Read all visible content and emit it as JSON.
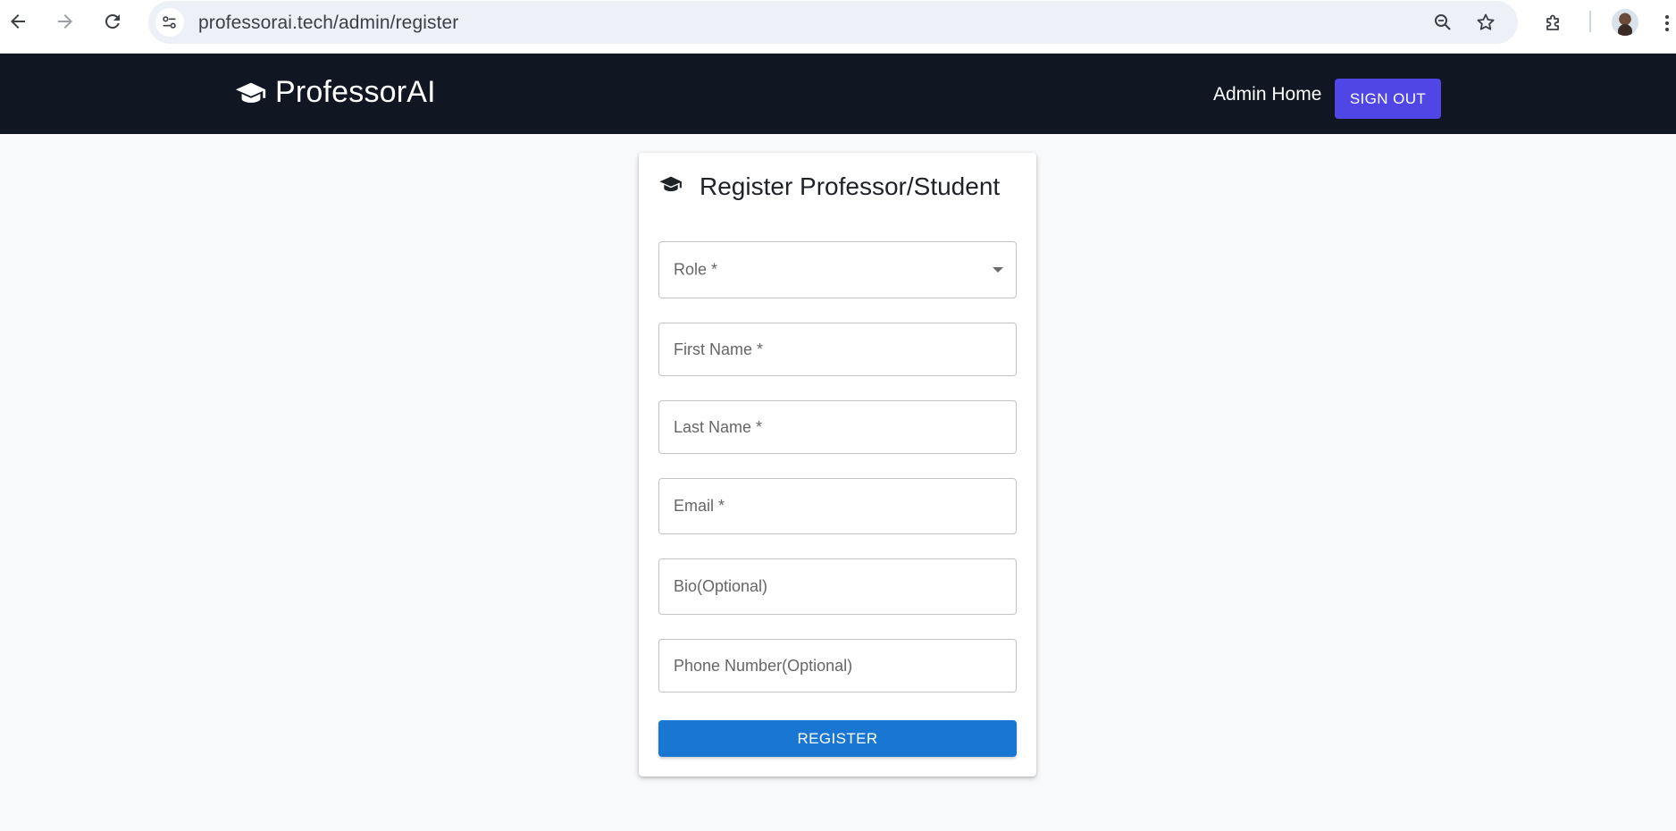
{
  "browser": {
    "url": "professorai.tech/admin/register",
    "icons": [
      "back-arrow-icon",
      "forward-arrow-icon",
      "reload-icon",
      "site-info-icon",
      "zoom-icon",
      "bookmark-star-icon",
      "extensions-puzzle-icon",
      "profile-avatar",
      "more-menu-icon"
    ]
  },
  "header": {
    "brand_name": "ProfessorAI",
    "brand_icon": "graduation-cap-icon",
    "nav_admin_home": "Admin Home",
    "sign_out_label": "SIGN OUT",
    "background_color": "#101722",
    "accent_color": "#4f46e5"
  },
  "form": {
    "title": "Register Professor/Student",
    "title_icon": "graduation-cap-icon",
    "role": {
      "label": "Role *",
      "value": ""
    },
    "first_name": {
      "placeholder": "First Name *",
      "value": ""
    },
    "last_name": {
      "placeholder": "Last Name *",
      "value": ""
    },
    "email": {
      "placeholder": "Email *",
      "value": ""
    },
    "bio": {
      "placeholder": "Bio(Optional)",
      "value": ""
    },
    "phone": {
      "placeholder": "Phone Number(Optional)",
      "value": ""
    },
    "submit_label": "REGISTER",
    "submit_color": "#1976d2"
  }
}
